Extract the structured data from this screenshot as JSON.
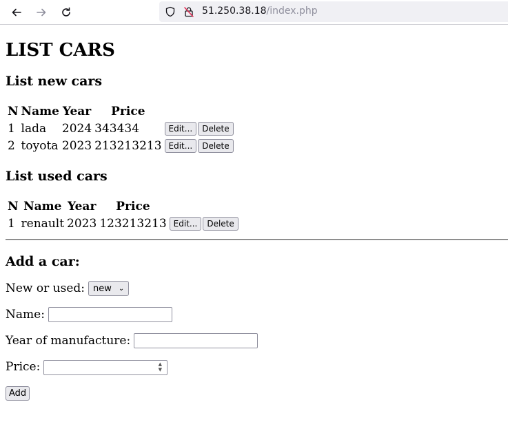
{
  "browser": {
    "url_host": "51.250.38.18",
    "url_path": "/index.php"
  },
  "page": {
    "title": "LIST CARS",
    "new_section": {
      "heading": "List new cars",
      "columns": [
        "N",
        "Name",
        "Year",
        "Price"
      ],
      "rows": [
        {
          "n": "1",
          "name": "lada",
          "year": "2024",
          "price": "343434"
        },
        {
          "n": "2",
          "name": "toyota",
          "year": "2023",
          "price": "213213213"
        }
      ]
    },
    "used_section": {
      "heading": "List used cars",
      "columns": [
        "N",
        "Name",
        "Year",
        "Price"
      ],
      "rows": [
        {
          "n": "1",
          "name": "renault",
          "year": "2023",
          "price": "123213213"
        }
      ]
    },
    "row_actions": {
      "edit": "Edit...",
      "delete": "Delete"
    },
    "form": {
      "heading": "Add a car:",
      "type_label": "New or used:",
      "type_selected": "new",
      "name_label": "Name:",
      "name_value": "",
      "year_label": "Year of manufacture:",
      "year_value": "",
      "price_label": "Price:",
      "price_value": "",
      "submit_label": "Add"
    }
  }
}
